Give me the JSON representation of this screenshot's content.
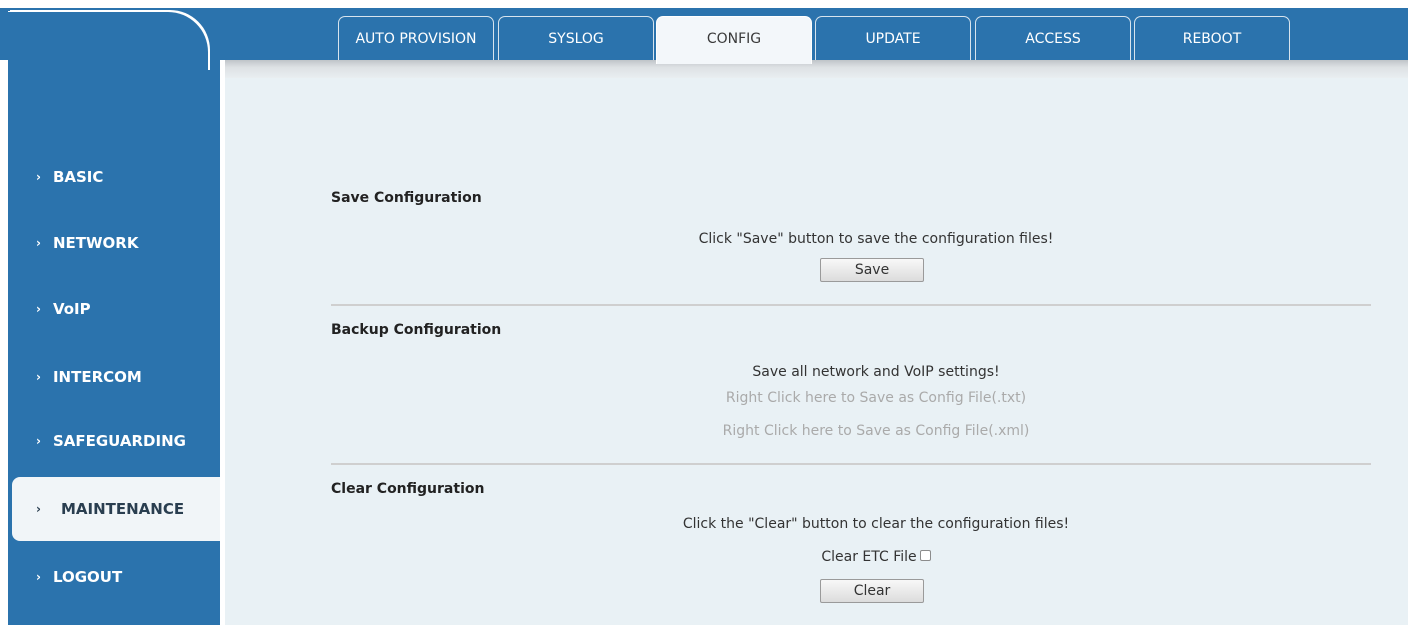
{
  "tabs": [
    {
      "label": "AUTO PROVISION",
      "active": false
    },
    {
      "label": "SYSLOG",
      "active": false
    },
    {
      "label": "CONFIG",
      "active": true
    },
    {
      "label": "UPDATE",
      "active": false
    },
    {
      "label": "ACCESS",
      "active": false
    },
    {
      "label": "REBOOT",
      "active": false
    }
  ],
  "sidebar": {
    "items": [
      {
        "label": "BASIC",
        "active": false
      },
      {
        "label": "NETWORK",
        "active": false
      },
      {
        "label": "VoIP",
        "active": false
      },
      {
        "label": "INTERCOM",
        "active": false
      },
      {
        "label": "SAFEGUARDING",
        "active": false
      },
      {
        "label": "MAINTENANCE",
        "active": true
      },
      {
        "label": "LOGOUT",
        "active": false
      }
    ],
    "chevron": "›"
  },
  "save": {
    "title": "Save Configuration",
    "description": "Click \"Save\" button to save the configuration files!",
    "button": "Save"
  },
  "backup": {
    "title": "Backup Configuration",
    "description": "Save all network and VoIP settings!",
    "link_txt": "Right Click here to Save as Config File(.txt)",
    "link_xml": "Right Click here to Save as Config File(.xml)"
  },
  "clear": {
    "title": "Clear Configuration",
    "description": "Click the \"Clear\" button to clear the configuration files!",
    "etc_label": "Clear ETC File",
    "etc_checked": false,
    "button": "Clear"
  },
  "colors": {
    "brand": "#2b73ad",
    "panel": "#e9f1f5"
  }
}
